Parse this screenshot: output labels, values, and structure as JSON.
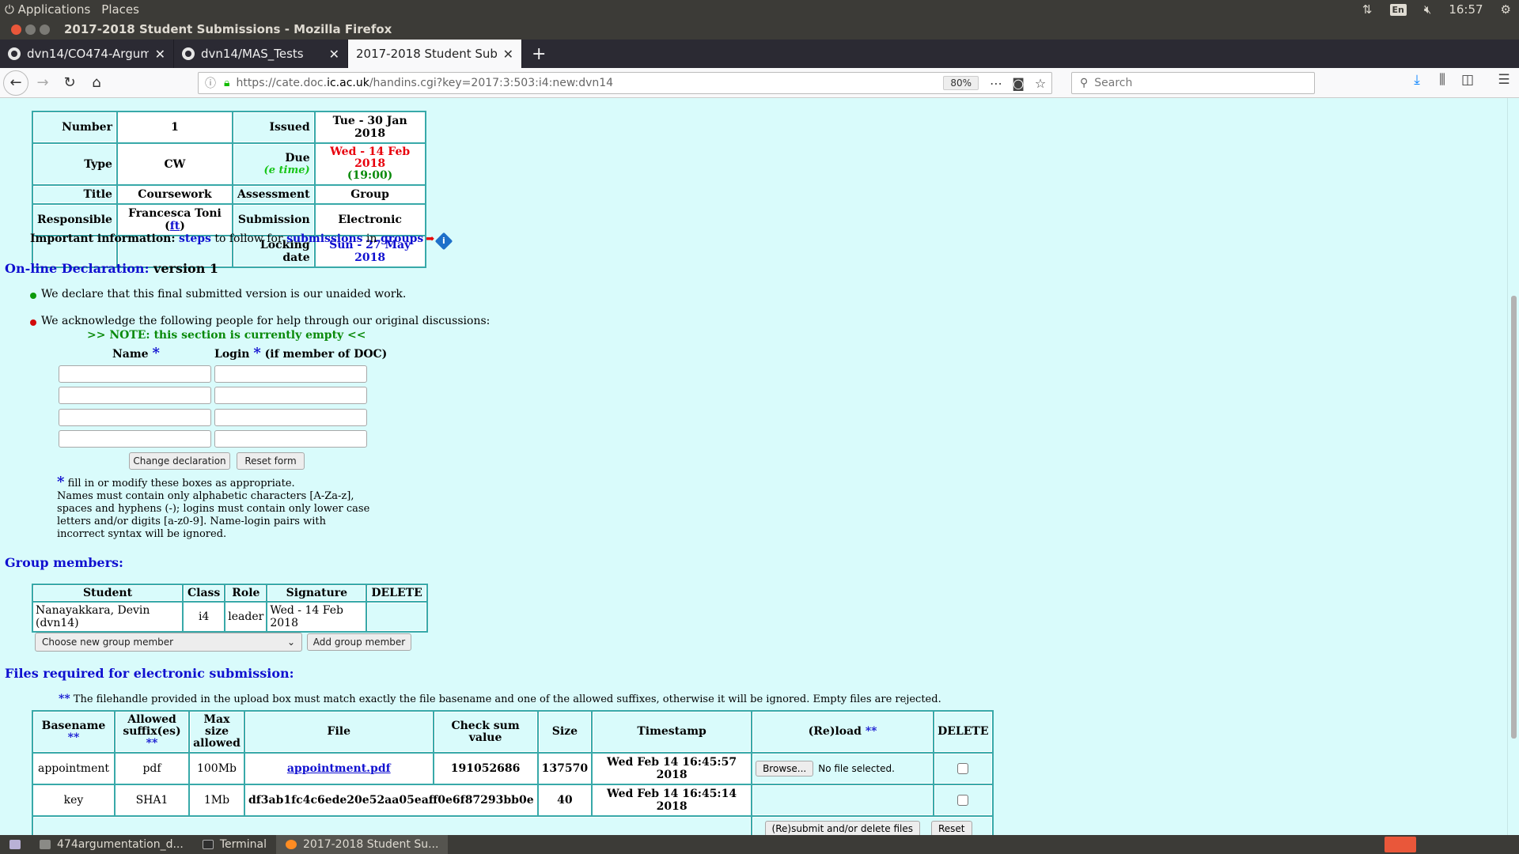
{
  "os": {
    "applications": "Applications",
    "places": "Places",
    "lang": "En",
    "clock": "16:57"
  },
  "window": {
    "title": "2017-2018 Student Submissions - Mozilla Firefox"
  },
  "tabs": [
    {
      "label": "dvn14/CO474-Argumen"
    },
    {
      "label": "dvn14/MAS_Tests"
    },
    {
      "label": "2017-2018 Student Submis"
    }
  ],
  "navbar": {
    "url_prefix": "https://cate.doc.",
    "url_domain": "ic.ac.uk",
    "url_path": "/handins.cgi?key=2017:3:503:i4:new:dvn14",
    "zoom": "80%",
    "search_placeholder": "Search"
  },
  "info": {
    "number_label": "Number",
    "number_value": "1",
    "issued_label": "Issued",
    "issued_value": "Tue - 30 Jan 2018",
    "type_label": "Type",
    "type_value": "CW",
    "due_label": "Due",
    "due_sub": "(e time)",
    "due_value": "Wed - 14 Feb 2018",
    "due_time": "(19:00)",
    "title_label": "Title",
    "title_value": "Coursework",
    "assessment_label": "Assessment",
    "assessment_value": "Group",
    "responsible_label": "Responsible",
    "responsible_value": "Francesca Toni (",
    "responsible_link": "ft",
    "responsible_close": ")",
    "submission_label": "Submission",
    "submission_value": "Electronic",
    "locking_label": "Locking date",
    "locking_value": "Sun - 27 May 2018"
  },
  "important": {
    "label": "Important information:",
    "steps": "steps",
    "t1": "to follow for",
    "submissions": "submissions",
    "t2": "in",
    "groups": "groups",
    "info_icon": "info-diamond-icon"
  },
  "declaration": {
    "heading": "On-line Declaration:",
    "version": "version 1",
    "stmt1": "We declare that this final submitted version is our unaided work.",
    "stmt2": "We acknowledge the following people for help through our original discussions:",
    "note": ">> NOTE: this section is currently empty <<",
    "col_name": "Name",
    "col_login": "Login",
    "col_login_suffix": "(if member of DOC)",
    "star": "*",
    "change_btn": "Change declaration",
    "reset_btn": "Reset form",
    "help_star_line": "fill in or modify these boxes as appropriate.",
    "help_text": "Names must contain only alphabetic characters [A-Za-z], spaces and hyphens (-); logins must contain only lower case letters and/or digits [a-z0-9]. Name-login pairs with incorrect syntax will be ignored."
  },
  "group": {
    "heading": "Group members:",
    "headers": [
      "Student",
      "Class",
      "Role",
      "Signature",
      "DELETE"
    ],
    "rows": [
      {
        "student": "Nanayakkara, Devin (dvn14)",
        "class": "i4",
        "role": "leader",
        "signature": "Wed - 14 Feb 2018"
      }
    ],
    "select_value": "Choose new group member",
    "add_btn": "Add group member"
  },
  "files": {
    "heading": "Files required for electronic submission:",
    "note_stars": "**",
    "note": "The filehandle provided in the upload box must match exactly the file basename and one of the allowed suffixes, otherwise it will be ignored.   Empty files are rejected.",
    "headers": {
      "basename": "Basename",
      "suffix_1": "Allowed",
      "suffix_2": "suffix(es)",
      "maxsize_1": "Max size",
      "maxsize_2": "allowed",
      "file": "File",
      "checksum_1": "Check sum",
      "checksum_2": "value",
      "size": "Size",
      "timestamp": "Timestamp",
      "reload": "(Re)load",
      "delete": "DELETE",
      "stars": "**"
    },
    "rows": [
      {
        "basename": "appointment",
        "suffix": "pdf",
        "maxsize": "100Mb",
        "file": "appointment.pdf",
        "checksum": "191052686",
        "size": "137570",
        "timestamp": "Wed Feb 14 16:45:57 2018",
        "browse": "Browse...",
        "nofile": "No file selected."
      },
      {
        "basename": "key",
        "suffix": "SHA1",
        "maxsize": "1Mb",
        "file": "df3ab1fc4c6ede20e52aa05eaff0e6f87293bb0e",
        "checksum": "",
        "size": "40",
        "timestamp": "Wed Feb 14 16:45:14 2018"
      }
    ],
    "submit_btn": "(Re)submit and/or delete files",
    "reset_btn": "Reset"
  },
  "taskbar": [
    {
      "label": "474argumentation_d..."
    },
    {
      "label": "Terminal"
    },
    {
      "label": "2017-2018 Student Su..."
    }
  ]
}
